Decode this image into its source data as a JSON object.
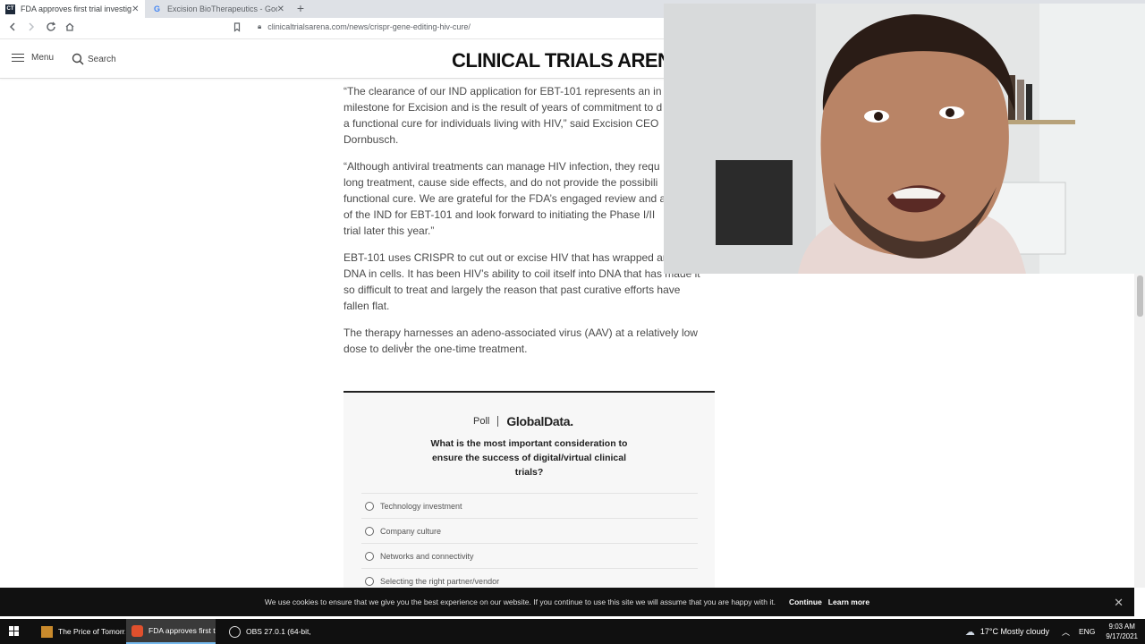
{
  "browser": {
    "tabs": [
      {
        "title": "FDA approves first trial investigat",
        "favicon": "CT",
        "active": true
      },
      {
        "title": "Excision BioTherapeutics - Google Sea",
        "favicon": "G",
        "active": false
      }
    ],
    "url": "clinicaltrialsarena.com/news/crispr-gene-editing-hiv-cure/"
  },
  "site": {
    "menu_label": "Menu",
    "search_label": "Search",
    "logo": "CLINICAL TRIALS AREN"
  },
  "article": {
    "paragraphs": [
      [
        "“The clearance of our IND application for EBT-101 represents an in",
        "milestone for Excision and is the result of years of commitment to d",
        "a functional cure for individuals living with HIV,” said Excision CEO",
        "Dornbusch."
      ],
      [
        "“Although antiviral treatments can manage HIV infection, they requ",
        "long treatment, cause side effects, and do not provide the possibili",
        "functional cure. We are grateful for the FDA’s engaged review and a",
        "of the IND for EBT-101 and look forward to initiating the Phase I/II",
        "trial later this year.”"
      ],
      [
        "EBT-101 uses CRISPR to cut out or excise HIV that has wrapped ar",
        "DNA in cells. It has been HIV’s ability to coil itself into DNA that has made it",
        "so difficult to treat and largely the reason that past curative efforts have",
        "fallen flat."
      ],
      [
        "The therapy harnesses an adeno-associated virus (AAV) at a relatively low",
        "dose to deliver the one-time treatment."
      ]
    ]
  },
  "poll": {
    "label": "Poll",
    "brand": "GlobalData.",
    "question": "What is the most important consideration to ensure the success of digital/virtual clinical trials?",
    "options": [
      "Technology investment",
      "Company culture",
      "Networks and connectivity",
      "Selecting the right partner/vendor"
    ]
  },
  "cookie": {
    "message": "We use cookies to ensure that we give you the best experience on our website. If you continue to use this site we will assume that you are happy with it.",
    "continue": "Continue",
    "learn_more": "Learn more"
  },
  "taskbar": {
    "items": [
      {
        "label": "The Price of Tomorr...",
        "icon": "book-icon",
        "active": false
      },
      {
        "label": "FDA approves first t...",
        "icon": "brave-browser-icon",
        "active": true
      },
      {
        "label": "OBS 27.0.1 (64-bit, ...",
        "icon": "obs-icon",
        "active": false
      }
    ],
    "weather": "17°C  Mostly cloudy",
    "lang": "ENG",
    "time": "9:03 AM",
    "date": "9/17/2021"
  },
  "colors": {
    "accent": "#76b9ed",
    "taskbar": "#101010",
    "cookie_banner": "#111111"
  }
}
